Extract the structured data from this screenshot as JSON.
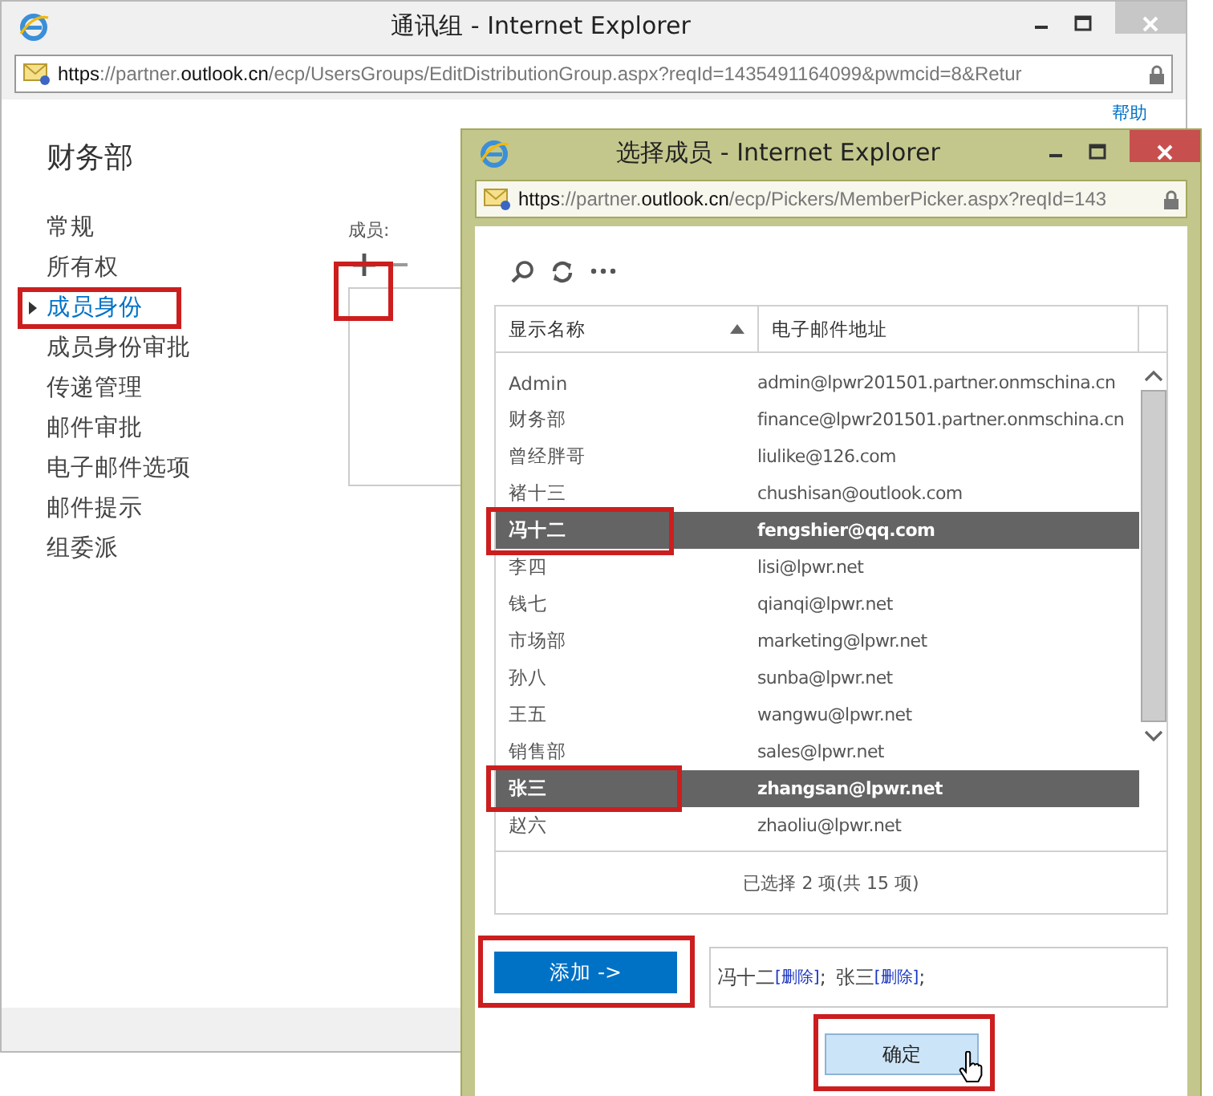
{
  "main_window": {
    "title": "通讯组 - Internet Explorer",
    "address": [
      {
        "text": "https",
        "emphasis": true
      },
      {
        "text": "://partner.",
        "emphasis": false
      },
      {
        "text": "outlook.cn",
        "emphasis": true
      },
      {
        "text": "/ecp/UsersGroups/EditDistributionGroup.aspx?reqId=1435491164099&pwmcid=8&Retur",
        "emphasis": false
      }
    ],
    "help_link": "帮助",
    "group_name": "财务部",
    "nav": [
      {
        "label": "常规",
        "selected": false
      },
      {
        "label": "所有权",
        "selected": false
      },
      {
        "label": "成员身份",
        "selected": true
      },
      {
        "label": "成员身份审批",
        "selected": false
      },
      {
        "label": "传递管理",
        "selected": false
      },
      {
        "label": "邮件审批",
        "selected": false
      },
      {
        "label": "电子邮件选项",
        "selected": false
      },
      {
        "label": "邮件提示",
        "selected": false
      },
      {
        "label": "组委派",
        "selected": false
      }
    ],
    "members_label": "成员:"
  },
  "picker_window": {
    "title": "选择成员 - Internet Explorer",
    "address": [
      {
        "text": "https",
        "emphasis": true
      },
      {
        "text": "://partner.",
        "emphasis": false
      },
      {
        "text": "outlook.cn",
        "emphasis": true
      },
      {
        "text": "/ecp/Pickers/MemberPicker.aspx?reqId=143",
        "emphasis": false
      }
    ],
    "columns": [
      {
        "label": "显示名称",
        "sorted": true
      },
      {
        "label": "电子邮件地址",
        "sorted": false
      }
    ],
    "rows": [
      {
        "name": "Admin",
        "email": "admin@lpwr201501.partner.onmschina.cn",
        "selected": false
      },
      {
        "name": "财务部",
        "email": "finance@lpwr201501.partner.onmschina.cn",
        "selected": false
      },
      {
        "name": "曾经胖哥",
        "email": "liulike@126.com",
        "selected": false
      },
      {
        "name": "褚十三",
        "email": "chushisan@outlook.com",
        "selected": false
      },
      {
        "name": "冯十二",
        "email": "fengshier@qq.com",
        "selected": true
      },
      {
        "name": "李四",
        "email": "lisi@lpwr.net",
        "selected": false
      },
      {
        "name": "钱七",
        "email": "qianqi@lpwr.net",
        "selected": false
      },
      {
        "name": "市场部",
        "email": "marketing@lpwr.net",
        "selected": false
      },
      {
        "name": "孙八",
        "email": "sunba@lpwr.net",
        "selected": false
      },
      {
        "name": "王五",
        "email": "wangwu@lpwr.net",
        "selected": false
      },
      {
        "name": "销售部",
        "email": "sales@lpwr.net",
        "selected": false
      },
      {
        "name": "张三",
        "email": "zhangsan@lpwr.net",
        "selected": true
      },
      {
        "name": "赵六",
        "email": "zhaoliu@lpwr.net",
        "selected": false
      }
    ],
    "status": "已选择 2 项(共 15 项)",
    "add_button": "添加 ->",
    "selected_members": [
      {
        "name": "冯十二",
        "link": "[删除]",
        "separator": ";"
      },
      {
        "name": "张三",
        "link": "[删除]",
        "separator": ";"
      }
    ],
    "ok_button": "确定"
  }
}
